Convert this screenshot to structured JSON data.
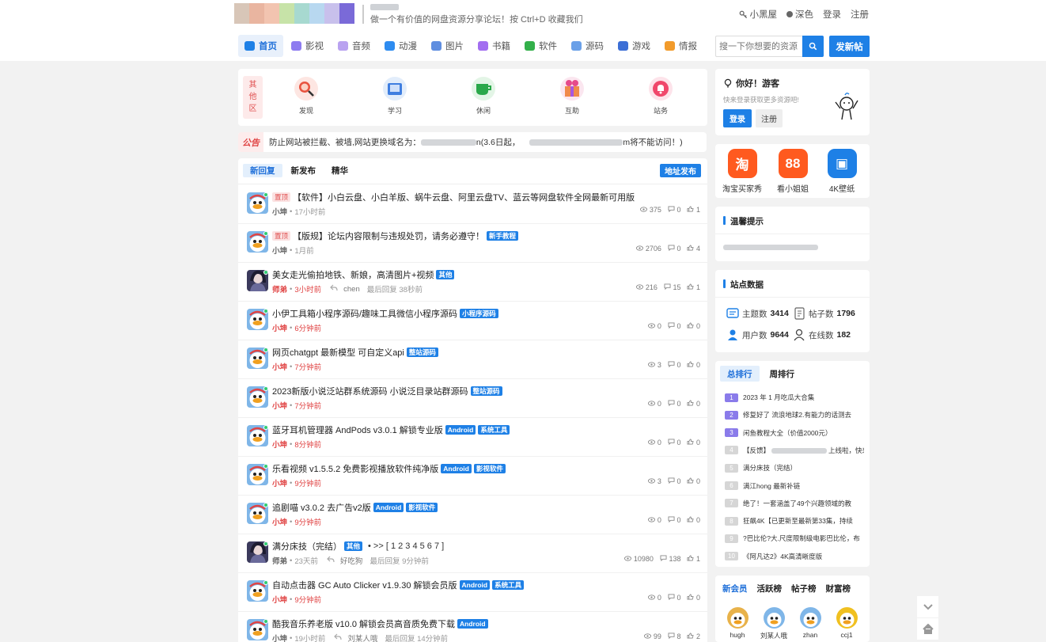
{
  "header": {
    "slogan": "做一个有价值的网盘资源分享论坛！按 Ctrl+D 收藏我们",
    "links": {
      "dark_room": "小黑屋",
      "dark_mode": "深色",
      "login": "登录",
      "register": "注册"
    },
    "search_placeholder": "搜一下你想要的资源",
    "post_button": "发新帖",
    "logo_colors": [
      "#d8c6b8",
      "#e9b5a0",
      "#f2c4b0",
      "#c7e3a8",
      "#a7d9d0",
      "#b8d8f0",
      "#c8c0ec",
      "#7a6ad8"
    ]
  },
  "nav": [
    {
      "label": "首页",
      "color": "#1e80e6",
      "active": true
    },
    {
      "label": "影视",
      "color": "#8e7cf0"
    },
    {
      "label": "音频",
      "color": "#b9a2f0"
    },
    {
      "label": "动漫",
      "color": "#2e8cf0"
    },
    {
      "label": "图片",
      "color": "#5f8ee0"
    },
    {
      "label": "书籍",
      "color": "#a26ef0"
    },
    {
      "label": "软件",
      "color": "#33b04a"
    },
    {
      "label": "源码",
      "color": "#6aa0e8"
    },
    {
      "label": "游戏",
      "color": "#3c6fd6"
    },
    {
      "label": "情报",
      "color": "#f29b2b"
    }
  ],
  "categories": {
    "tag": "其他区",
    "items": [
      {
        "label": "发现",
        "color": "#fde6e2",
        "icon": "search"
      },
      {
        "label": "学习",
        "color": "#e2edfb",
        "icon": "book"
      },
      {
        "label": "休闲",
        "color": "#e3f5e6",
        "icon": "cup"
      },
      {
        "label": "互助",
        "color": "#fbe6ef",
        "icon": "gift"
      },
      {
        "label": "站务",
        "color": "#fde3ea",
        "icon": "bell"
      }
    ]
  },
  "notice": {
    "tag": "公告",
    "text_before": "防止网站被拦截、被墙,网站更换域名为：",
    "text_mid1": "n(3.6日起，",
    "text_mid2": "m将不能访问！)"
  },
  "list": {
    "tabs": [
      "新回复",
      "新发布",
      "精华"
    ],
    "address_button": "地址发布",
    "posts": [
      {
        "title": "【软件】小白云盘、小白羊版、蜗牛云盘、阿里云盘TV、蓝云等网盘软件全网最新可用版",
        "pre_badge": "置顶",
        "badges": [],
        "user": "小坤",
        "user_red": false,
        "time": "17小时前",
        "time_red": false,
        "reply": "",
        "views": "375",
        "comments": "0",
        "likes": "1",
        "avatar": "duck"
      },
      {
        "title": "【版规】论坛内容限制与违规处罚，请务必遵守！",
        "pre_badge": "置顶",
        "badges": [
          "新手教程"
        ],
        "user": "小坤",
        "user_red": false,
        "time": "1月前",
        "time_red": false,
        "reply": "",
        "views": "2706",
        "comments": "0",
        "likes": "4",
        "avatar": "duck"
      },
      {
        "title": "美女走光偷拍地铁、新娘，高清图片+视频",
        "pre_badge": "",
        "badges": [
          "其他"
        ],
        "user": "师弟",
        "user_red": true,
        "time": "3小时前",
        "time_red": true,
        "reply_user": "chen",
        "reply": "最后回复 38秒前",
        "views": "216",
        "comments": "15",
        "likes": "1",
        "avatar": "girl"
      },
      {
        "title": "小伊工具箱小程序源码/趣味工具微信小程序源码",
        "pre_badge": "",
        "badges": [
          "小程序源码"
        ],
        "user": "小坤",
        "user_red": true,
        "time": "6分钟前",
        "time_red": true,
        "reply": "",
        "views": "0",
        "comments": "0",
        "likes": "0",
        "avatar": "duck"
      },
      {
        "title": "网页chatgpt 最新模型 可自定义api",
        "pre_badge": "",
        "badges": [
          "整站源码"
        ],
        "user": "小坤",
        "user_red": true,
        "time": "7分钟前",
        "time_red": true,
        "reply": "",
        "views": "3",
        "comments": "0",
        "likes": "0",
        "avatar": "duck"
      },
      {
        "title": "2023新版小说泛站群系统源码 小说泛目录站群源码",
        "pre_badge": "",
        "badges": [
          "整站源码"
        ],
        "user": "小坤",
        "user_red": true,
        "time": "7分钟前",
        "time_red": true,
        "reply": "",
        "views": "0",
        "comments": "0",
        "likes": "0",
        "avatar": "duck"
      },
      {
        "title": "蓝牙耳机管理器 AndPods v3.0.1 解锁专业版",
        "pre_badge": "",
        "badges": [
          "Android",
          "系统工具"
        ],
        "user": "小坤",
        "user_red": true,
        "time": "8分钟前",
        "time_red": true,
        "reply": "",
        "views": "0",
        "comments": "0",
        "likes": "0",
        "avatar": "duck"
      },
      {
        "title": "乐看视频 v1.5.5.2 免费影视播放软件纯净版",
        "pre_badge": "",
        "badges": [
          "Android",
          "影视软件"
        ],
        "user": "小坤",
        "user_red": true,
        "time": "9分钟前",
        "time_red": true,
        "reply": "",
        "views": "3",
        "comments": "0",
        "likes": "0",
        "avatar": "duck"
      },
      {
        "title": "追剧喵 v3.0.2 去广告v2版",
        "pre_badge": "",
        "badges": [
          "Android",
          "影视软件"
        ],
        "user": "小坤",
        "user_red": true,
        "time": "9分钟前",
        "time_red": true,
        "reply": "",
        "views": "0",
        "comments": "0",
        "likes": "0",
        "avatar": "duck"
      },
      {
        "title": "满分床技（完结）",
        "pre_badge": "",
        "badges": [
          "其他"
        ],
        "pages": "• >> [ 1 2 3 4 5 6 7 ]",
        "user": "师弟",
        "user_red": false,
        "time": "23天前",
        "time_red": false,
        "reply_user": "好吃狗",
        "reply": "最后回复 9分钟前",
        "views": "10980",
        "comments": "138",
        "likes": "1",
        "avatar": "girl"
      },
      {
        "title": "自动点击器 GC Auto Clicker v1.9.30 解锁会员版",
        "pre_badge": "",
        "badges": [
          "Android",
          "系统工具"
        ],
        "user": "小坤",
        "user_red": true,
        "time": "9分钟前",
        "time_red": true,
        "reply": "",
        "views": "0",
        "comments": "0",
        "likes": "0",
        "avatar": "duck"
      },
      {
        "title": "酷我音乐养老版 v10.0 解锁会员高音质免费下载",
        "pre_badge": "",
        "badges": [
          "Android"
        ],
        "user": "小坤",
        "user_red": false,
        "time": "19小时前",
        "time_red": false,
        "reply_user": "刘某人哦",
        "reply": "最后回复 14分钟前",
        "views": "99",
        "comments": "8",
        "likes": "2",
        "avatar": "duck"
      }
    ]
  },
  "sidebar": {
    "welcome": {
      "title": "你好！游客",
      "subtitle": "快来登录获取更多资源吧!",
      "login": "登录",
      "register": "注册"
    },
    "apps": [
      {
        "label": "淘宝买家秀",
        "glyph": "淘",
        "color": "#ff5a1f"
      },
      {
        "label": "看小姐姐",
        "glyph": "88",
        "color": "#ff5a1f"
      },
      {
        "label": "4K壁纸",
        "glyph": "▣",
        "color": "#1e80e6"
      }
    ],
    "tips_title": "温馨提示",
    "stats_title": "站点数据",
    "stats": [
      {
        "label": "主题数",
        "value": "3414"
      },
      {
        "label": "帖子数",
        "value": "1796"
      },
      {
        "label": "用户数",
        "value": "9644"
      },
      {
        "label": "在线数",
        "value": "182"
      }
    ],
    "rank_tabs": [
      "总排行",
      "周排行"
    ],
    "ranks": [
      {
        "no": "1",
        "text": "2023 年 1 月吃瓜大合集"
      },
      {
        "no": "2",
        "text": "修复好了 流浪地球2.有能力的话测去"
      },
      {
        "no": "3",
        "text": "闲鱼教程大全（价值2000元）"
      },
      {
        "no": "4",
        "text": "【反馈】",
        "text2": "上线啦，快来提交"
      },
      {
        "no": "5",
        "text": "满分床技（完结）"
      },
      {
        "no": "6",
        "text": "满江hong 最新补链"
      },
      {
        "no": "7",
        "text": "绝了！一套涵盖了49个兴趣领域的教"
      },
      {
        "no": "8",
        "text": "狂飙4K【已更新至最新第33集，持续"
      },
      {
        "no": "9",
        "text": "?巴比伦?大.尺度限制级电影巴比伦，布"
      },
      {
        "no": "10",
        "text": "《阿凡达2》4K高清晰度版"
      }
    ],
    "member_tabs": [
      "新会员",
      "活跃榜",
      "帖子榜",
      "财富榜"
    ],
    "members": [
      "hugh",
      "刘某人哦",
      "zhan",
      "ccj1"
    ]
  }
}
